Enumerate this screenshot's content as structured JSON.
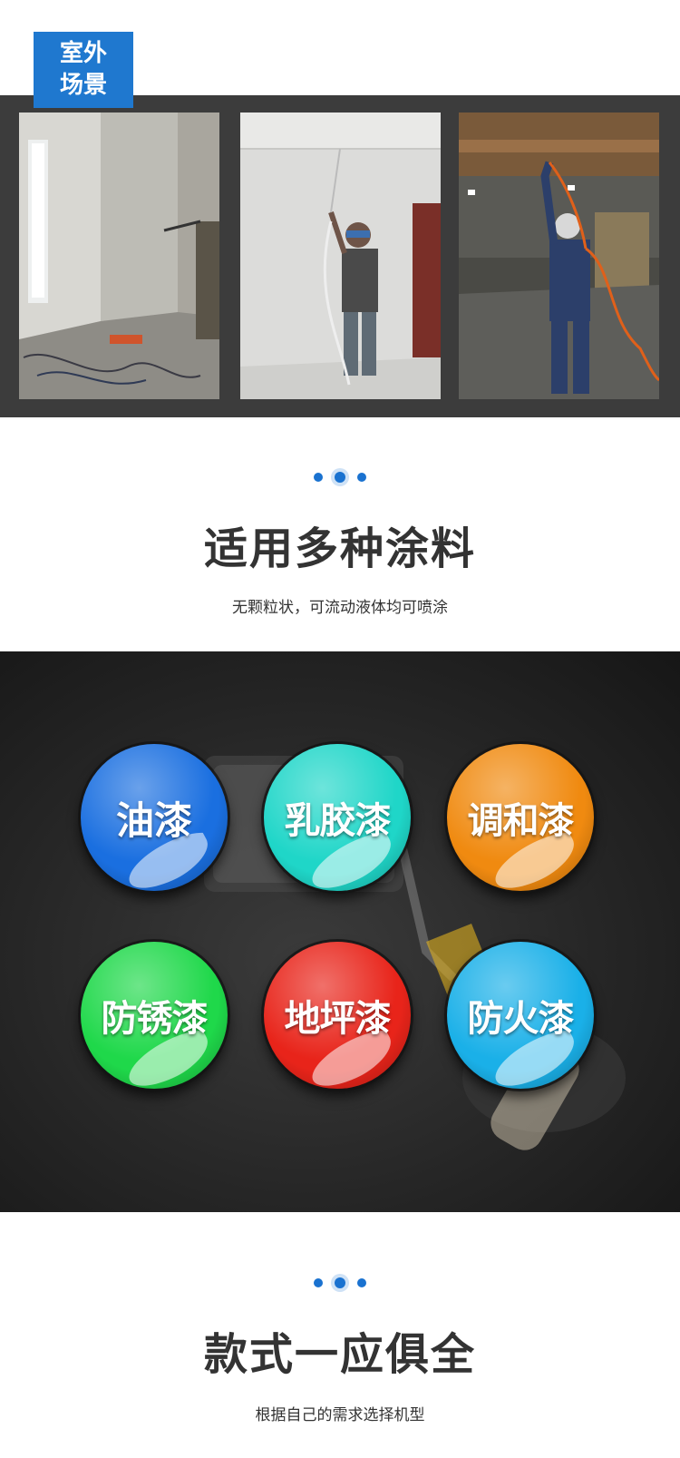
{
  "scene": {
    "tag_line1": "室外",
    "tag_line2": "场景",
    "band_color": "#3c3c3c",
    "tag_color": "#1f78cf"
  },
  "section_paints": {
    "title": "适用多种涂料",
    "subtitle": "无颗粒状，可流动液体均可喷涂",
    "items": [
      {
        "label": "油漆",
        "color": "#1a6fe0"
      },
      {
        "label": "乳胶漆",
        "color": "#1fd6c8"
      },
      {
        "label": "调和漆",
        "color": "#f08a10"
      },
      {
        "label": "防锈漆",
        "color": "#1fd84a"
      },
      {
        "label": "地坪漆",
        "color": "#e8241a"
      },
      {
        "label": "防火漆",
        "color": "#1ab0e8"
      }
    ]
  },
  "section_models": {
    "title": "款式一应俱全",
    "subtitle": "根据自己的需求选择机型"
  },
  "accent_color": "#1a72d0"
}
